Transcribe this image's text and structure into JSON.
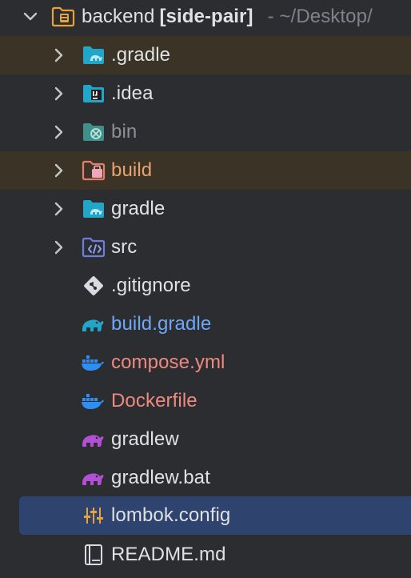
{
  "colors": {
    "background": "#2b2d30",
    "excluded_row": "#3b3326",
    "selected_row": "#2e436e",
    "text_default": "#dfe1e5",
    "text_excluded": "#8c8f94",
    "text_build_dir": "#e8a26c",
    "text_gradle_file": "#6ea7f7",
    "text_docker_file": "#ef8a80",
    "folder_teal": "#21a6c9",
    "folder_build": "#e0806f",
    "folder_src": "#6c7fdc",
    "gradle_purple": "#b24fd6",
    "docker_blue": "#2f8ef2"
  },
  "project": {
    "name": "backend",
    "module": "[side-pair]",
    "path": "- ~/Desktop/",
    "expanded": true
  },
  "tree": {
    "folders": [
      {
        "name": ".gradle",
        "icon": "folder-gradle-icon"
      },
      {
        "name": ".idea",
        "icon": "folder-idea-icon"
      },
      {
        "name": "bin",
        "icon": "folder-excluded-icon"
      },
      {
        "name": "build",
        "icon": "folder-build-output-icon"
      },
      {
        "name": "gradle",
        "icon": "folder-gradle-icon"
      },
      {
        "name": "src",
        "icon": "folder-source-icon"
      }
    ],
    "files": [
      {
        "name": ".gitignore",
        "icon": "git-ignore-icon"
      },
      {
        "name": "build.gradle",
        "icon": "gradle-elephant-icon"
      },
      {
        "name": "compose.yml",
        "icon": "docker-whale-icon"
      },
      {
        "name": "Dockerfile",
        "icon": "docker-whale-icon"
      },
      {
        "name": "gradlew",
        "icon": "gradle-wrapper-icon"
      },
      {
        "name": "gradlew.bat",
        "icon": "gradle-wrapper-icon"
      },
      {
        "name": "lombok.config",
        "icon": "config-sliders-icon",
        "selected": true
      },
      {
        "name": "README.md",
        "icon": "readme-book-icon"
      }
    ]
  }
}
